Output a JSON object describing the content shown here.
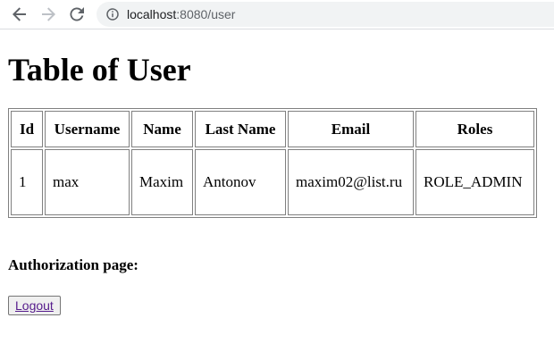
{
  "browser": {
    "url_host": "localhost",
    "url_rest": ":8080/user",
    "icons": {
      "back": "arrow-left-icon",
      "forward": "arrow-right-icon",
      "reload": "reload-icon",
      "site_info": "info-icon"
    }
  },
  "page": {
    "title": "Table of User",
    "table": {
      "headers": {
        "id": "Id",
        "username": "Username",
        "name": "Name",
        "last_name": "Last Name",
        "email": "Email",
        "roles": "Roles"
      },
      "rows": [
        {
          "id": "1",
          "username": "max",
          "name": "Maxim",
          "last_name": "Antonov",
          "email": "maxim02@list.ru",
          "roles": "ROLE_ADMIN"
        }
      ]
    },
    "auth_heading": "Authorization page:",
    "logout_label": "Logout"
  },
  "colors": {
    "link_visited": "#551a8b",
    "table_border": "#808080",
    "omnibox_bg": "#f1f3f4"
  }
}
